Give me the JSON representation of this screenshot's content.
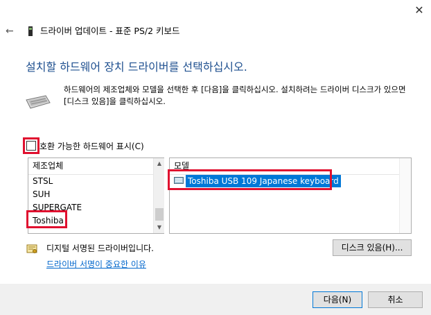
{
  "window": {
    "close_glyph": "✕",
    "back_glyph": "←",
    "title": "드라이버 업데이트 - 표준 PS/2 키보드"
  },
  "heading": "설치할 하드웨어 장치 드라이버를 선택하십시오.",
  "description": "하드웨어의 제조업체와 모델을 선택한 후 [다음]을 클릭하십시오. 설치하려는 드라이버 디스크가 있으면 [디스크 있음]을 클릭하십시오.",
  "compatible": {
    "label": "호환 가능한 하드웨어 표시(C)",
    "checked": false
  },
  "manufacturers": {
    "header": "제조업체",
    "items": [
      "STSL",
      "SUH",
      "SUPERGATE",
      "Toshiba"
    ],
    "selected": "Toshiba"
  },
  "models": {
    "header": "모델",
    "items": [
      "Toshiba USB 109 Japanese keyboard"
    ],
    "selected": "Toshiba USB 109 Japanese keyboard"
  },
  "signed": {
    "text": "디지털 서명된 드라이버입니다.",
    "link": "드라이버 서명이 중요한 이유"
  },
  "buttons": {
    "have_disk": "디스크 있음(H)...",
    "next": "다음(N)",
    "cancel": "취소"
  },
  "colors": {
    "heading": "#1e4f8f",
    "highlight": "#e0102f",
    "selection": "#0078d7",
    "link": "#0066cc"
  }
}
